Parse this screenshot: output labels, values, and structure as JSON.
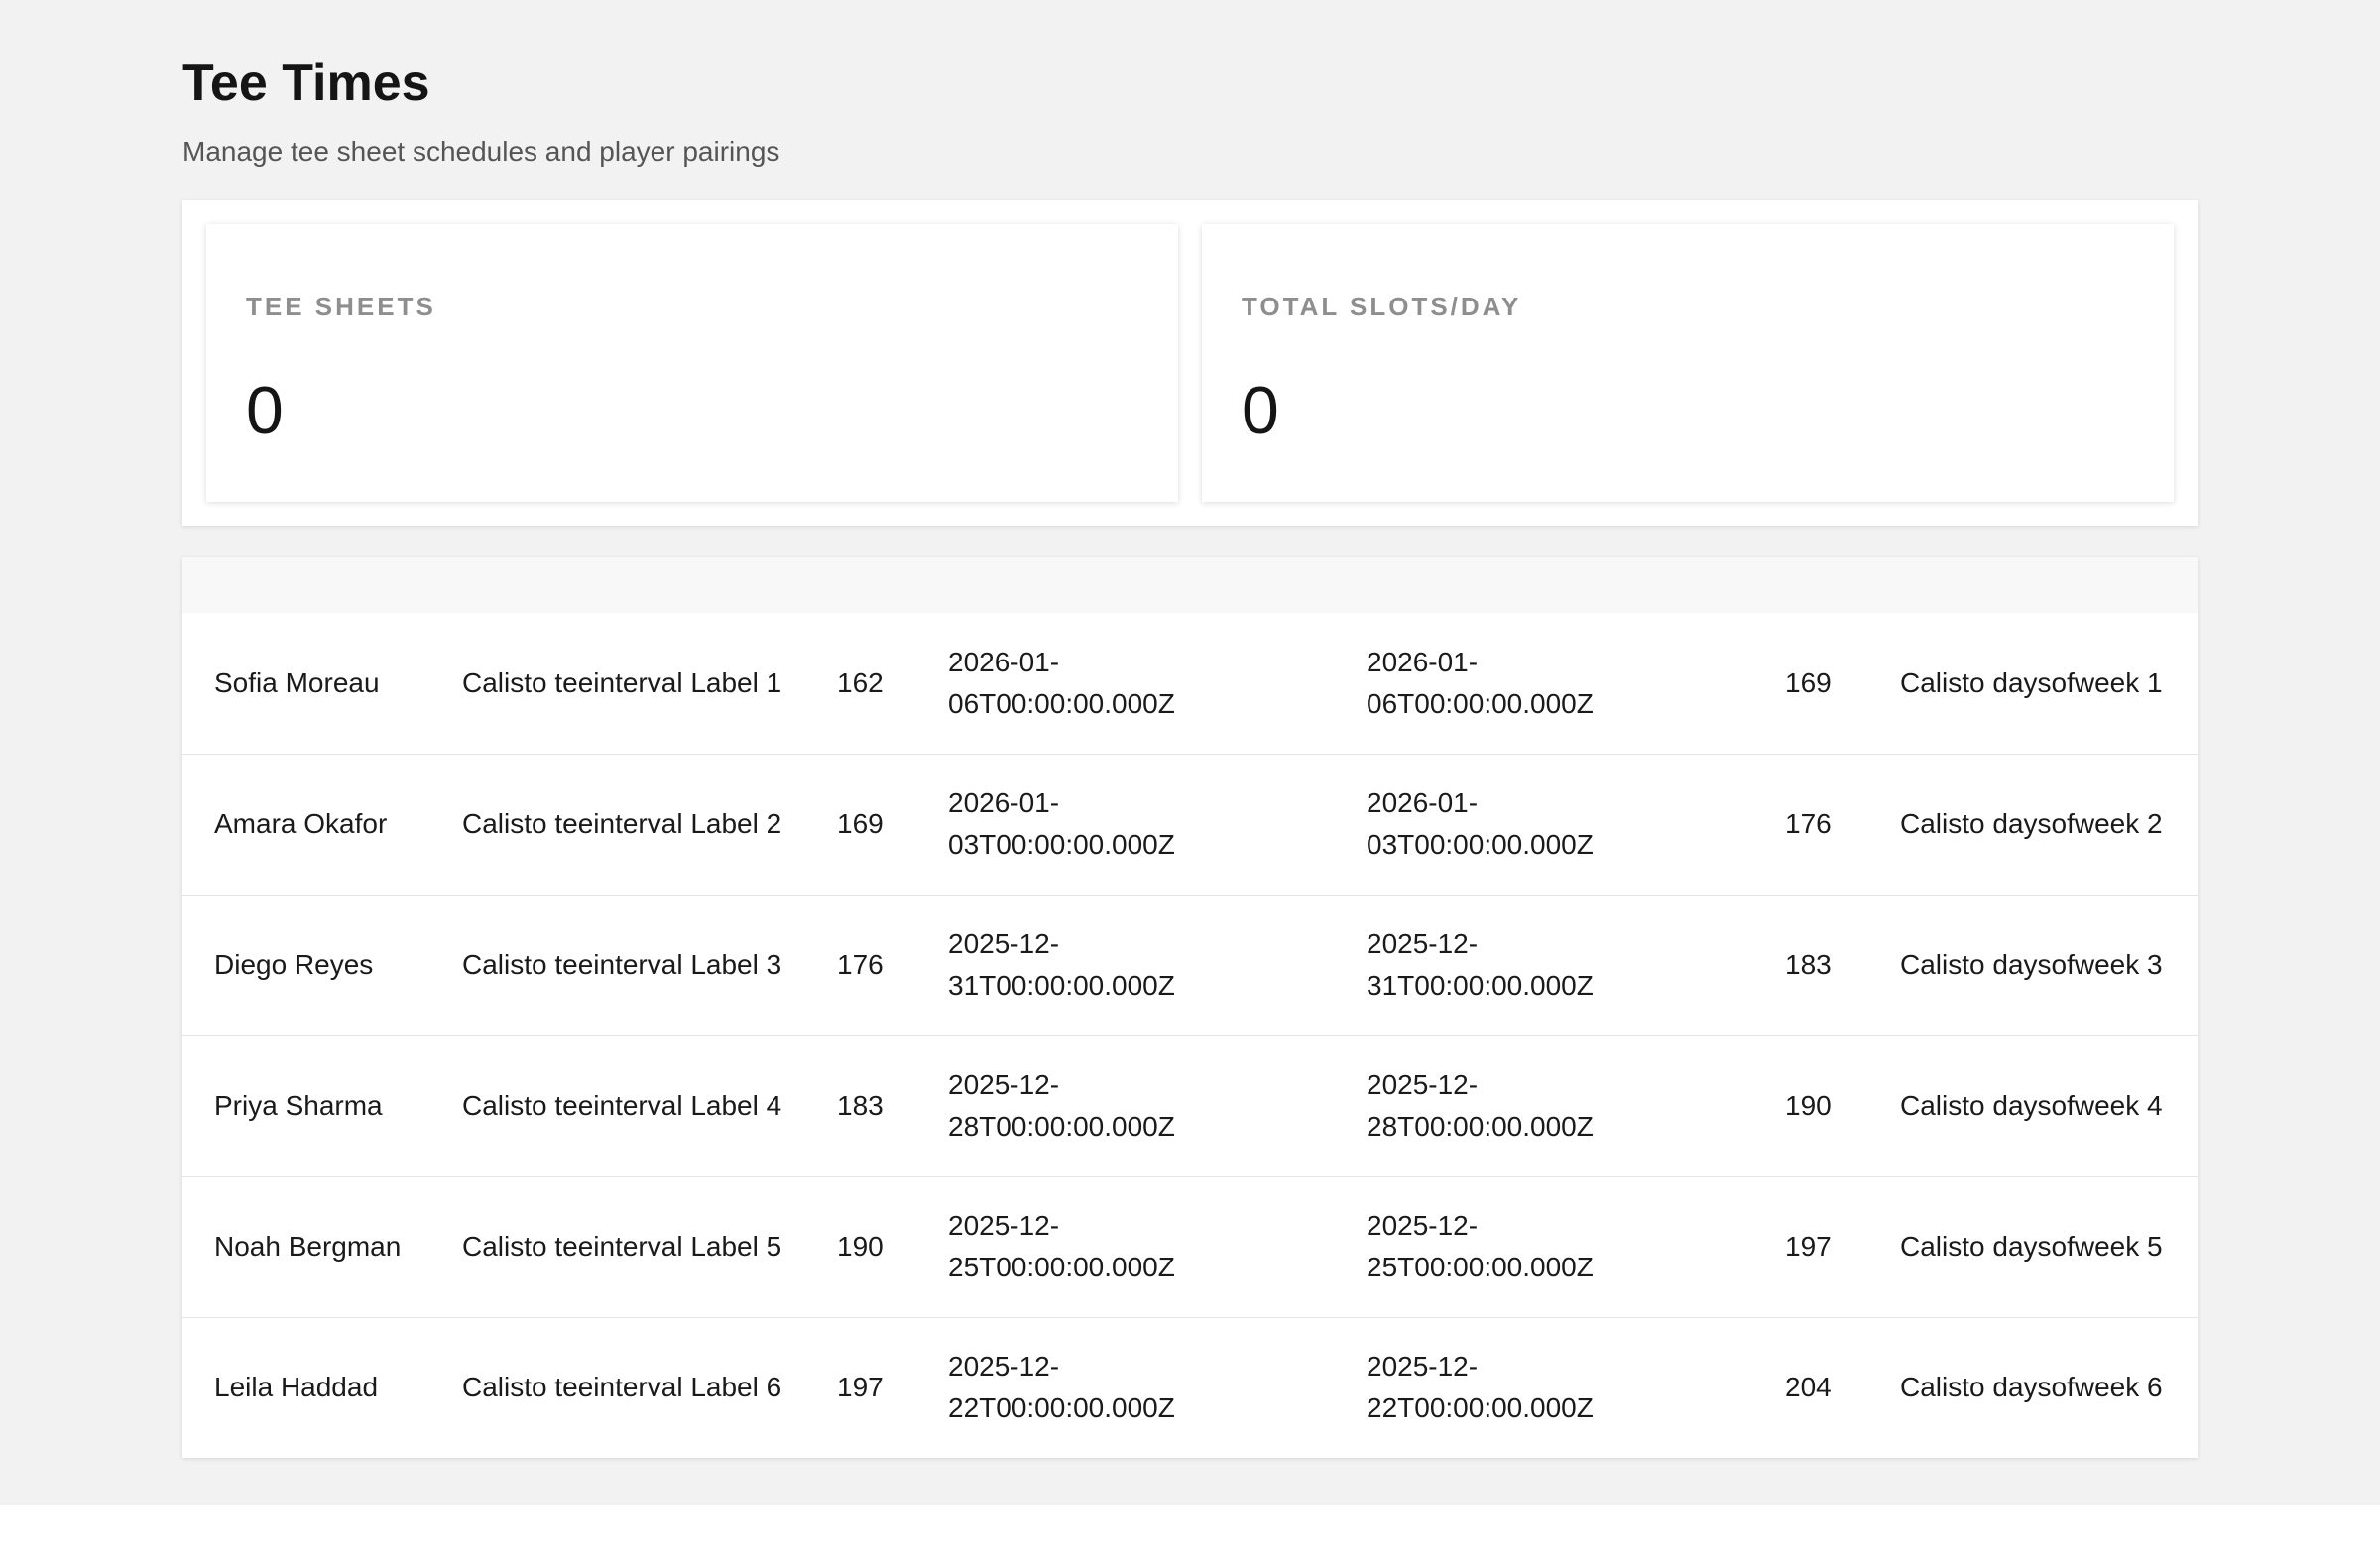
{
  "header": {
    "title": "Tee Times",
    "subtitle": "Manage tee sheet schedules and player pairings"
  },
  "stats": [
    {
      "label": "TEE SHEETS",
      "value": "0"
    },
    {
      "label": "TOTAL SLOTS/DAY",
      "value": "0"
    }
  ],
  "table": {
    "rows": [
      {
        "name": "Sofia Moreau",
        "interval": "Calisto teeinterval Label 1",
        "num1": "162",
        "date1_a": "2026-01-",
        "date1_b": "06T00:00:00.000Z",
        "date2_a": "2026-01-",
        "date2_b": "06T00:00:00.000Z",
        "num2": "169",
        "days": "Calisto daysofweek 1"
      },
      {
        "name": "Amara Okafor",
        "interval": "Calisto teeinterval Label 2",
        "num1": "169",
        "date1_a": "2026-01-",
        "date1_b": "03T00:00:00.000Z",
        "date2_a": "2026-01-",
        "date2_b": "03T00:00:00.000Z",
        "num2": "176",
        "days": "Calisto daysofweek 2"
      },
      {
        "name": "Diego Reyes",
        "interval": "Calisto teeinterval Label 3",
        "num1": "176",
        "date1_a": "2025-12-",
        "date1_b": "31T00:00:00.000Z",
        "date2_a": "2025-12-",
        "date2_b": "31T00:00:00.000Z",
        "num2": "183",
        "days": "Calisto daysofweek 3"
      },
      {
        "name": "Priya Sharma",
        "interval": "Calisto teeinterval Label 4",
        "num1": "183",
        "date1_a": "2025-12-",
        "date1_b": "28T00:00:00.000Z",
        "date2_a": "2025-12-",
        "date2_b": "28T00:00:00.000Z",
        "num2": "190",
        "days": "Calisto daysofweek 4"
      },
      {
        "name": "Noah Bergman",
        "interval": "Calisto teeinterval Label 5",
        "num1": "190",
        "date1_a": "2025-12-",
        "date1_b": "25T00:00:00.000Z",
        "date2_a": "2025-12-",
        "date2_b": "25T00:00:00.000Z",
        "num2": "197",
        "days": "Calisto daysofweek 5"
      },
      {
        "name": "Leila Haddad",
        "interval": "Calisto teeinterval Label 6",
        "num1": "197",
        "date1_a": "2025-12-",
        "date1_b": "22T00:00:00.000Z",
        "date2_a": "2025-12-",
        "date2_b": "22T00:00:00.000Z",
        "num2": "204",
        "days": "Calisto daysofweek 6"
      }
    ]
  }
}
